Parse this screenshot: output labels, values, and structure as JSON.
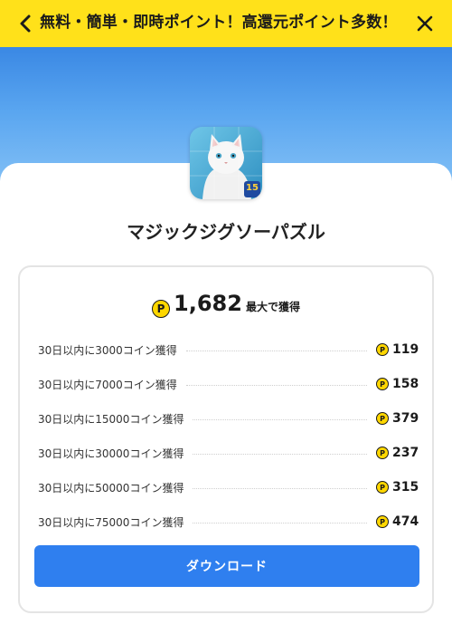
{
  "header": {
    "title": "無料・簡単・即時ポイント！高還元ポイント多数！",
    "back_icon": "chevron-left-icon",
    "close_icon": "close-icon"
  },
  "colors": {
    "header_bg": "#ffe11a",
    "hero_gradient_top": "#3a88e4",
    "accent_blue": "#2f7fef",
    "coin": "#ffd700"
  },
  "app": {
    "name": "マジックジグソーパズル",
    "icon": "app-icon-white-cat-puzzle",
    "badge": "15"
  },
  "reward": {
    "coin_symbol": "P",
    "total": "1,682",
    "total_suffix": "最大で獲得"
  },
  "tasks": [
    {
      "label": "30日以内に3000コイン獲得",
      "points": "119"
    },
    {
      "label": "30日以内に7000コイン獲得",
      "points": "158"
    },
    {
      "label": "30日以内に15000コイン獲得",
      "points": "379"
    },
    {
      "label": "30日以内に30000コイン獲得",
      "points": "237"
    },
    {
      "label": "30日以内に50000コイン獲得",
      "points": "315"
    },
    {
      "label": "30日以内に75000コイン獲得",
      "points": "474"
    }
  ],
  "download_button": {
    "label": "ダウンロード"
  }
}
